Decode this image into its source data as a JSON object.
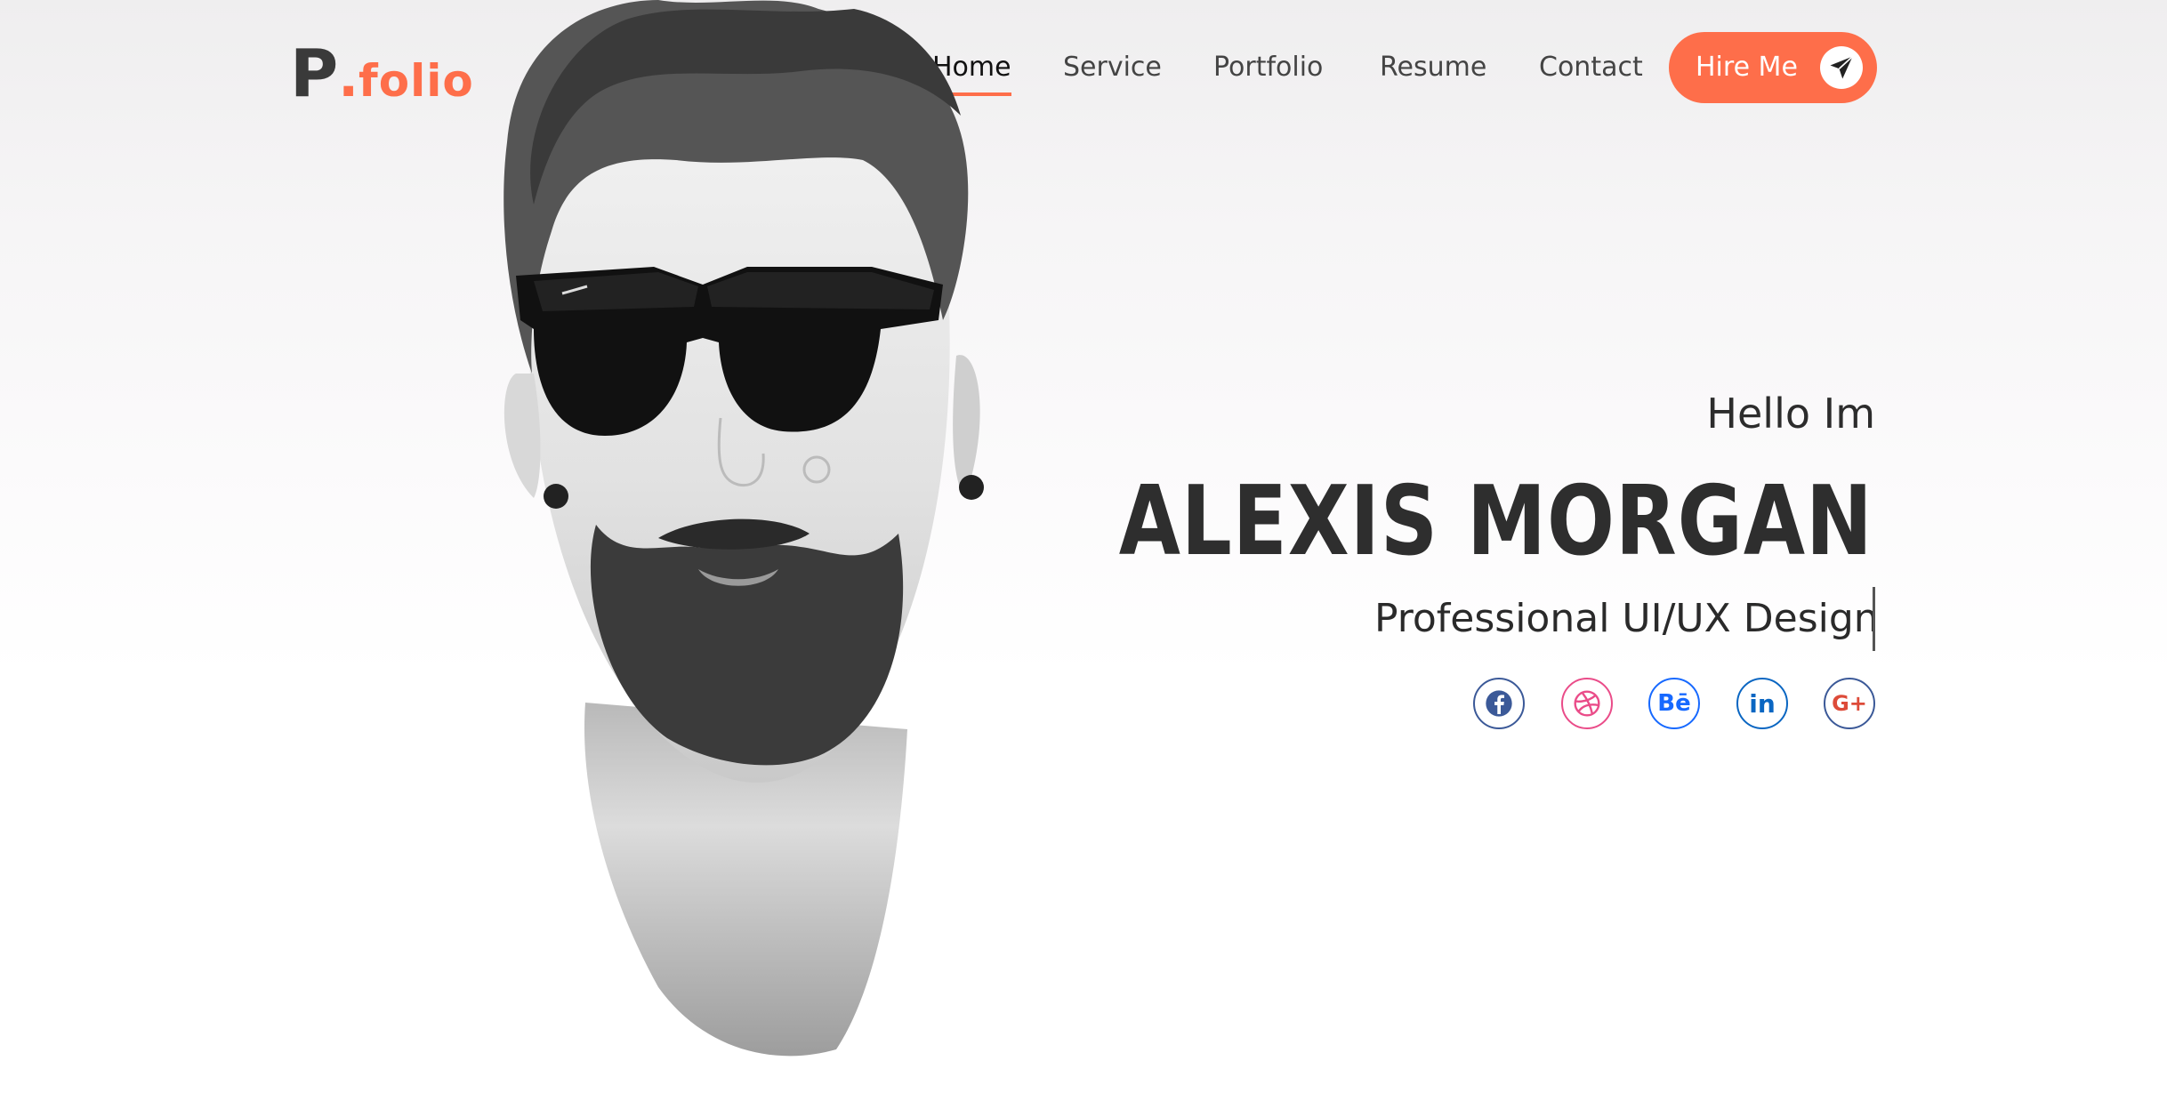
{
  "logo": {
    "mark": "P",
    "dot": ".",
    "text": "folio"
  },
  "nav": {
    "items": [
      {
        "label": "Home",
        "active": true
      },
      {
        "label": "Service"
      },
      {
        "label": "Portfolio"
      },
      {
        "label": "Resume"
      },
      {
        "label": "Contact"
      }
    ]
  },
  "hire_button": {
    "label": "Hire Me",
    "icon": "paper-plane-icon"
  },
  "hero": {
    "greeting": "Hello Im",
    "name": "ALEXIS MORGAN",
    "role": "Professional UI/UX Design"
  },
  "socials": [
    {
      "name": "facebook",
      "icon": "facebook-icon",
      "color": "#3b5998"
    },
    {
      "name": "dribbble",
      "icon": "dribbble-icon",
      "color": "#ea4c89"
    },
    {
      "name": "behance",
      "icon": "behance-icon",
      "glyph": "Bē",
      "color": "#1769ff"
    },
    {
      "name": "linkedin",
      "icon": "linkedin-icon",
      "glyph": "in",
      "color": "#0a66c2"
    },
    {
      "name": "google-plus",
      "icon": "google-plus-icon",
      "glyph": "G+",
      "color": "#dd4b39"
    }
  ],
  "colors": {
    "accent": "#fe6e4a",
    "text": "#2e2e2e",
    "background": "#ffffff"
  }
}
